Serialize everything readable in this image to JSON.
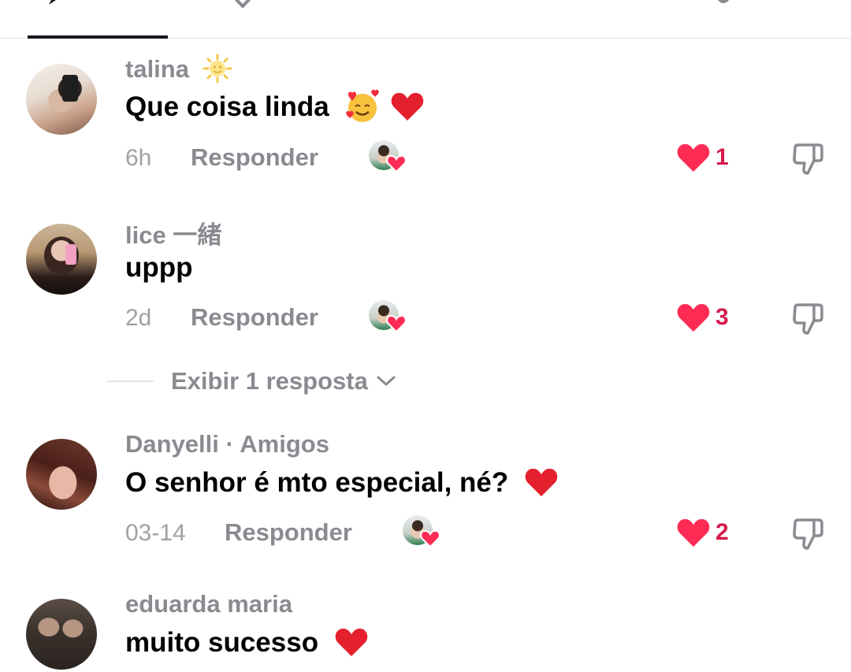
{
  "colors": {
    "username": "#8a8b91",
    "body": "#000000",
    "like_heart": "#fe2c55",
    "like_count": "#d41c4d",
    "divider": "#e3e3e3",
    "tab_underline": "#161823"
  },
  "tabs": [
    {
      "icon": "comment-icon",
      "active": true
    },
    {
      "icon": "heart-outline-icon",
      "active": false
    }
  ],
  "comments": [
    {
      "username": "talina",
      "username_emoji": "sun-emoji",
      "text": "Que coisa linda",
      "emojis": [
        "smiling-face-with-hearts-emoji",
        "red-heart-emoji"
      ],
      "time": "6h",
      "reply_label": "Responder",
      "creator_liked": true,
      "likes": "1",
      "liked": true
    },
    {
      "username": "lice 一緒",
      "text": "uppp",
      "emojis": [],
      "time": "2d",
      "reply_label": "Responder",
      "creator_liked": true,
      "likes": "3",
      "liked": true,
      "view_replies": "Exibir 1 resposta"
    },
    {
      "username": "Danyelli · Amigos",
      "text": "O senhor é mto especial, né?",
      "emojis": [
        "red-heart-emoji"
      ],
      "time": "03-14",
      "reply_label": "Responder",
      "creator_liked": true,
      "likes": "2",
      "liked": true
    },
    {
      "username": "eduarda maria",
      "text": "muito sucesso",
      "emojis": [
        "red-heart-emoji"
      ]
    }
  ]
}
